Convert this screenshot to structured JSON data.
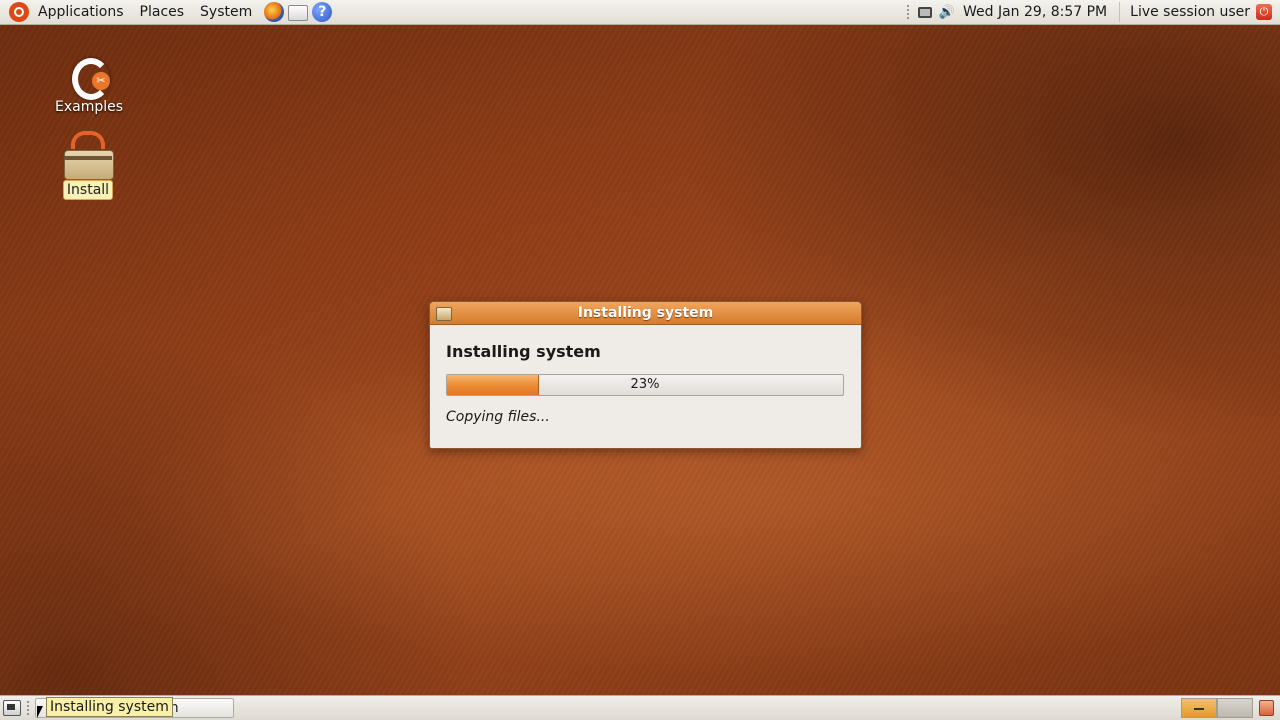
{
  "top_panel": {
    "menus": [
      "Applications",
      "Places",
      "System"
    ],
    "launchers": [
      "firefox-icon",
      "mail-icon",
      "help-icon"
    ],
    "help_glyph": "?",
    "clock": "Wed Jan 29,  8:57 PM",
    "user": "Live session user"
  },
  "desktop": {
    "icons": [
      {
        "label": "Examples",
        "icon": "examples-icon",
        "selected": false
      },
      {
        "label": "Install",
        "icon": "install-icon",
        "selected": true
      }
    ]
  },
  "dialog": {
    "window_title": "Installing system",
    "heading": "Installing system",
    "progress": 23,
    "progress_text": "23%",
    "status": "Copying files..."
  },
  "bottom_panel": {
    "taskbar_button_visible_text": "m",
    "tooltip": "Installing system",
    "workspaces": 2,
    "active_workspace": 1
  },
  "colors": {
    "accent": "#e0782a",
    "wallpaper": "#8a3b16",
    "tooltip_bg": "#f9f0a8"
  }
}
